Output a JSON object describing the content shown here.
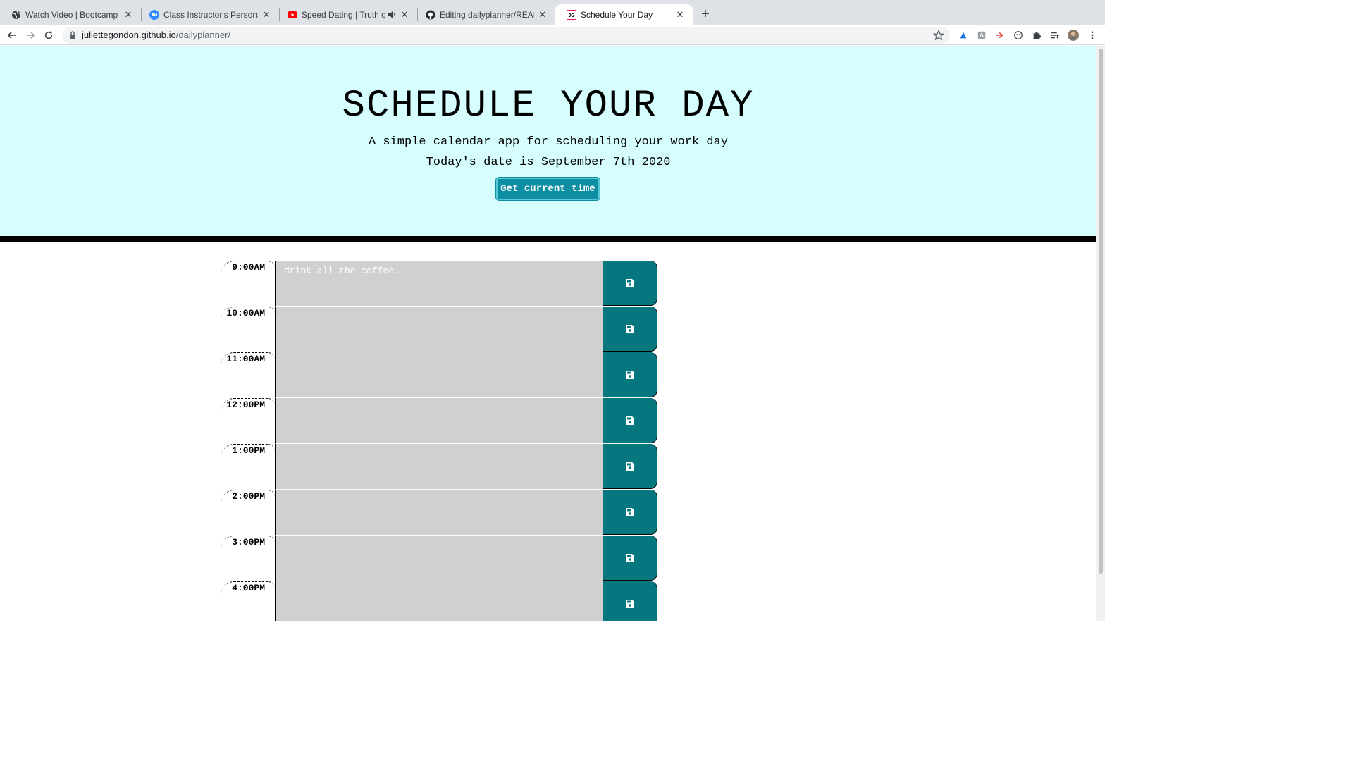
{
  "browser": {
    "tabs": [
      {
        "title": "Watch Video | Bootcamp Spot",
        "icon": "globe-icon",
        "active": false
      },
      {
        "title": "Class Instructor's Personal Me",
        "icon": "zoom-icon",
        "active": false
      },
      {
        "title": "Speed Dating | Truth or Dri",
        "icon": "youtube-icon",
        "active": false
      },
      {
        "title": "Editing dailyplanner/README.m",
        "icon": "github-icon",
        "active": false
      },
      {
        "title": "Schedule Your Day",
        "icon": "jg-icon",
        "active": true
      }
    ],
    "url_host": "juliettegondon.github.io",
    "url_path": "/dailyplanner/"
  },
  "header": {
    "title": "SCHEDULE YOUR DAY",
    "subtitle": "A simple calendar app for scheduling your work day",
    "date_text": "Today's date is September 7th 2020",
    "button_label": "Get current time"
  },
  "schedule": [
    {
      "hour": "9:00AM",
      "text": "drink all the coffee."
    },
    {
      "hour": "10:00AM",
      "text": ""
    },
    {
      "hour": "11:00AM",
      "text": ""
    },
    {
      "hour": "12:00PM",
      "text": ""
    },
    {
      "hour": "1:00PM",
      "text": ""
    },
    {
      "hour": "2:00PM",
      "text": ""
    },
    {
      "hour": "3:00PM",
      "text": ""
    },
    {
      "hour": "4:00PM",
      "text": ""
    }
  ],
  "colors": {
    "header_bg": "#d6fefe",
    "button_bg": "#0e8ea3",
    "save_bg": "#06777e",
    "row_bg": "#d0d0d0"
  }
}
